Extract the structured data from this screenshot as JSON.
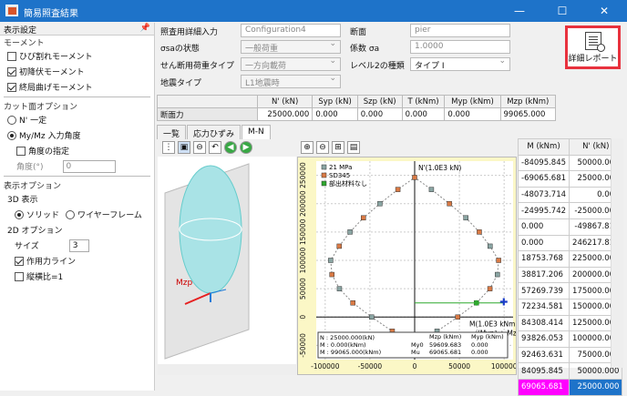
{
  "window": {
    "title": "簡易照査結果",
    "min": "—",
    "max": "☐",
    "close": "✕"
  },
  "left": {
    "header": "表示設定",
    "pin": "📌",
    "moment_group": "モーメント",
    "moment_items": [
      {
        "label": "ひび割れモーメント",
        "checked": false
      },
      {
        "label": "初降伏モーメント",
        "checked": true
      },
      {
        "label": "終局曲げモーメント",
        "checked": true
      }
    ],
    "cut_group": "カット面オプション",
    "radio_n": "N' 一定",
    "radio_mymz": "My/Mz 入力角度",
    "angle_spec": "角度の指定",
    "angle_label": "角度(°)",
    "angle_value": "0",
    "display_group": "表示オプション",
    "d3": "3D 表示",
    "solid": "ソリッド",
    "wire": "ワイヤーフレーム",
    "d2": "2D オプション",
    "size_label": "サイズ",
    "size_value": "3",
    "action_line": "作用力ライン",
    "aspect": "縦横比=1"
  },
  "form": {
    "input_label": "照査用詳細入力",
    "input_value": "Configuration4",
    "section_label": "断面",
    "section_value": "pier",
    "sigma_label": "σsaの状態",
    "sigma_value": "一般荷重",
    "coef_label": "係数 σa",
    "coef_value": "1.0000",
    "shear_label": "せん断用荷重タイプ",
    "shear_value": "一方向載荷",
    "level2_label": "レベル2の種類",
    "level2_value": "タイプ I",
    "quake_label": "地震タイプ",
    "quake_value": "L1地震時"
  },
  "report_button": "詳細レポート",
  "forces": {
    "headers": [
      "",
      "N' (kN)",
      "Syp (kN)",
      "Szp (kN)",
      "T (kNm)",
      "Myp (kNm)",
      "Mzp (kNm)"
    ],
    "row": [
      "断面力",
      "25000.000",
      "0.000",
      "0.000",
      "0.000",
      "0.000",
      "99065.000"
    ]
  },
  "tabs": [
    "一覧",
    "応力ひずみ",
    "M-N"
  ],
  "right_table": {
    "headers": [
      "M (kNm)",
      "N' (kN)"
    ],
    "rows": [
      [
        "-84095.845",
        "50000.000"
      ],
      [
        "-69065.681",
        "25000.000"
      ],
      [
        "-48073.714",
        "0.000"
      ],
      [
        "-24995.742",
        "-25000.000"
      ],
      [
        "0.000",
        "-49867.818"
      ],
      [
        "0.000",
        "246217.818"
      ],
      [
        "18753.768",
        "225000.000"
      ],
      [
        "38817.206",
        "200000.000"
      ],
      [
        "57269.739",
        "175000.000"
      ],
      [
        "72234.581",
        "150000.000"
      ],
      [
        "84308.414",
        "125000.000"
      ],
      [
        "93826.053",
        "100000.000"
      ],
      [
        "92463.631",
        "75000.000"
      ],
      [
        "84095.845",
        "50000.000"
      ],
      [
        "69065.681",
        "25000.000"
      ]
    ]
  },
  "chart_data": {
    "type": "scatter",
    "xlabel": "M(1.0E3 kNm)",
    "ylabel": "N'(1.0E3 kN)",
    "formula": "√(Myp² + Mzp²)",
    "legend": [
      "21 MPa",
      "SD345",
      "部出材料なし"
    ],
    "x_ticks": [
      "-100000",
      "-50000",
      "0",
      "50000",
      "100000"
    ],
    "y_ticks": [
      "250000",
      "200000",
      "150000",
      "100000",
      "50000",
      "0",
      "-50000"
    ],
    "xlim": [
      -110000,
      110000
    ],
    "ylim": [
      -75000,
      275000
    ],
    "series": [
      {
        "name": "",
        "values": [
          [
            -84095,
            50000
          ],
          [
            -69065,
            25000
          ],
          [
            -48073,
            0
          ],
          [
            -24995,
            -25000
          ],
          [
            0,
            -49867
          ],
          [
            0,
            246217
          ],
          [
            18753,
            225000
          ],
          [
            38817,
            200000
          ],
          [
            57269,
            175000
          ],
          [
            72234,
            150000
          ],
          [
            84308,
            125000
          ],
          [
            93826,
            100000
          ],
          [
            92463,
            75000
          ],
          [
            84095,
            50000
          ],
          [
            69065,
            25000
          ],
          [
            48073,
            0
          ],
          [
            24995,
            -25000
          ],
          [
            -18753,
            225000
          ],
          [
            -38817,
            200000
          ],
          [
            -57269,
            175000
          ],
          [
            -72234,
            150000
          ],
          [
            -84308,
            125000
          ],
          [
            -93826,
            100000
          ],
          [
            -92463,
            75000
          ]
        ]
      }
    ],
    "action_point": [
      99065,
      25000
    ],
    "notes": {
      "n": "N : 25000.000(kN)",
      "mi": "M : 0.000(kNm)",
      "mzp": "M : 99065.000(kNm)"
    },
    "mini_headers": [
      "",
      "Mzp (kNm)",
      "Myp (kNm)"
    ],
    "mini_rows": [
      [
        "My0",
        "59609.683",
        "0.000"
      ],
      [
        "Mu",
        "69065.681",
        "0.000"
      ]
    ]
  }
}
